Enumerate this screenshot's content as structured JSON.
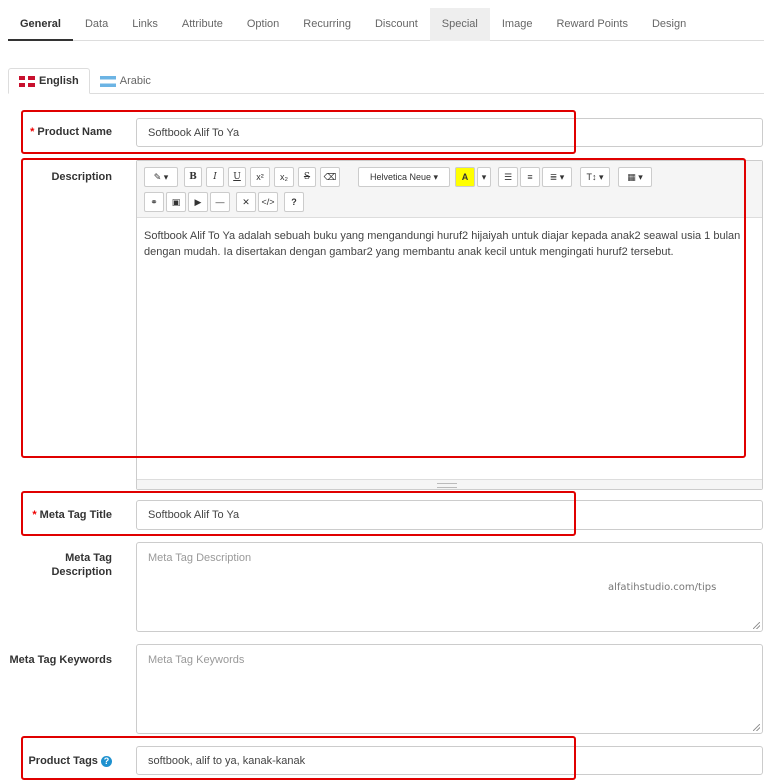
{
  "tabs": [
    {
      "label": "General"
    },
    {
      "label": "Data"
    },
    {
      "label": "Links"
    },
    {
      "label": "Attribute"
    },
    {
      "label": "Option"
    },
    {
      "label": "Recurring"
    },
    {
      "label": "Discount"
    },
    {
      "label": "Special"
    },
    {
      "label": "Image"
    },
    {
      "label": "Reward Points"
    },
    {
      "label": "Design"
    }
  ],
  "languages": [
    {
      "label": "English"
    },
    {
      "label": "Arabic"
    }
  ],
  "product_name": {
    "label": "Product Name",
    "value": "Softbook Alif To Ya"
  },
  "description": {
    "label": "Description",
    "text": "Softbook Alif To Ya adalah sebuah buku yang mengandungi huruf2 hijaiyah untuk diajar kepada anak2 seawal usia 1 bulan dengan mudah. Ia disertakan dengan gambar2 yang membantu anak kecil untuk mengingati huruf2 tersebut.",
    "toolbar": {
      "bold": "B",
      "italic": "I",
      "underline": "U",
      "superscript": "x²",
      "subscript": "x₂",
      "strikethrough": "S",
      "font": "Helvetica Neue ▾",
      "color": "A",
      "height": "T↕ ▾",
      "help": "?"
    }
  },
  "meta_title": {
    "label": "Meta Tag Title",
    "value": "Softbook Alif To Ya"
  },
  "meta_description": {
    "label": "Meta Tag Description",
    "placeholder": "Meta Tag Description"
  },
  "meta_keywords": {
    "label": "Meta Tag Keywords",
    "placeholder": "Meta Tag Keywords"
  },
  "product_tags": {
    "label": "Product Tags",
    "value": "softbook, alif to ya, kanak-kanak"
  },
  "watermark": "alfatihstudio.com/tips",
  "colors": {
    "highlight": "#e00000",
    "required": "#e00000",
    "help": "#1e91cf"
  }
}
